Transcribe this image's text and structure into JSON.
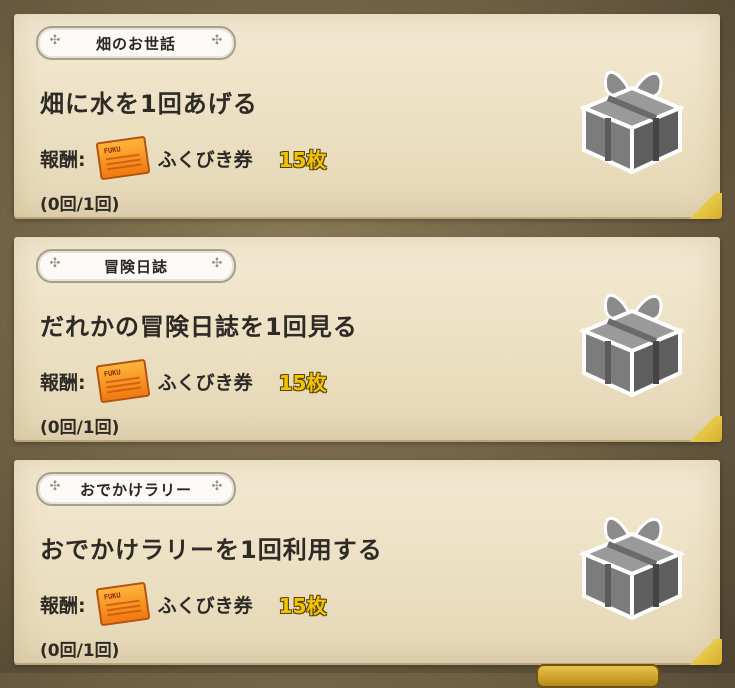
{
  "missions": [
    {
      "category": "畑のお世話",
      "title": "畑に水を1回あげる",
      "reward_label": "報酬:",
      "reward_item": "ふくびき券",
      "reward_count": "15枚",
      "progress": "(0回/1回)",
      "icon": "gift-box-icon"
    },
    {
      "category": "冒険日誌",
      "title": "だれかの冒険日誌を1回見る",
      "reward_label": "報酬:",
      "reward_item": "ふくびき券",
      "reward_count": "15枚",
      "progress": "(0回/1回)",
      "icon": "gift-box-icon"
    },
    {
      "category": "おでかけラリー",
      "title": "おでかけラリーを1回利用する",
      "reward_label": "報酬:",
      "reward_item": "ふくびき券",
      "reward_count": "15枚",
      "progress": "(0回/1回)",
      "icon": "gift-box-icon"
    }
  ],
  "colors": {
    "reward_count": "#f2c400",
    "card": "#efe4c8",
    "ticket": "#f58a1a"
  }
}
